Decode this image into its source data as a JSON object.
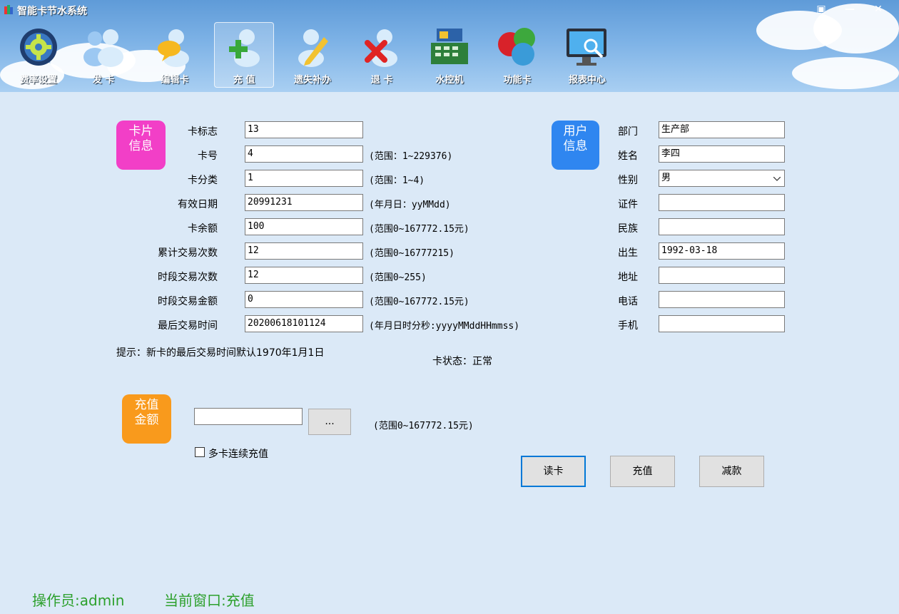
{
  "window": {
    "title": "智能卡节水系统",
    "controls": [
      "▣",
      "—",
      "✕"
    ]
  },
  "toolbar": [
    {
      "label": "费率设置",
      "icon": "gear-icon"
    },
    {
      "label": "发  卡",
      "icon": "users-icon"
    },
    {
      "label": "编辑卡",
      "icon": "user-chat-icon"
    },
    {
      "label": "充  值",
      "icon": "user-add-icon",
      "active": true
    },
    {
      "label": "遗失补办",
      "icon": "user-edit-icon"
    },
    {
      "label": "退  卡",
      "icon": "user-remove-icon"
    },
    {
      "label": "水控机",
      "icon": "cash-register-icon"
    },
    {
      "label": "功能卡",
      "icon": "color-balls-icon"
    },
    {
      "label": "报表中心",
      "icon": "monitor-search-icon"
    }
  ],
  "card_info": {
    "badge": [
      "卡片",
      "信息"
    ],
    "fields": [
      {
        "label": "卡标志",
        "value": "13",
        "hint": ""
      },
      {
        "label": "卡号",
        "value": "4",
        "hint": "(范围：1~229376)"
      },
      {
        "label": "卡分类",
        "value": "1",
        "hint": "(范围：1~4)"
      },
      {
        "label": "有效日期",
        "value": "20991231",
        "hint": "(年月日：yyMMdd)"
      },
      {
        "label": "卡余额",
        "value": "100",
        "hint": "(范围0~167772.15元)"
      },
      {
        "label": "累计交易次数",
        "value": "12",
        "hint": "(范围0~16777215)"
      },
      {
        "label": "时段交易次数",
        "value": "12",
        "hint": "(范围0~255)"
      },
      {
        "label": "时段交易金额",
        "value": "0",
        "hint": "(范围0~167772.15元)"
      },
      {
        "label": "最后交易时间",
        "value": "20200618101124",
        "hint": "(年月日时分秒:yyyyMMddHHmmss)"
      }
    ],
    "tip": "提示：新卡的最后交易时间默认1970年1月1日",
    "card_status": "卡状态：正常"
  },
  "user_info": {
    "badge": [
      "用户",
      "信息"
    ],
    "fields": [
      {
        "label": "部门",
        "value": "生产部"
      },
      {
        "label": "姓名",
        "value": "李四"
      },
      {
        "label": "性别",
        "value": "男",
        "select": true
      },
      {
        "label": "证件",
        "value": ""
      },
      {
        "label": "民族",
        "value": ""
      },
      {
        "label": "出生",
        "value": "1992-03-18"
      },
      {
        "label": "地址",
        "value": ""
      },
      {
        "label": "电话",
        "value": ""
      },
      {
        "label": "手机",
        "value": ""
      }
    ]
  },
  "recharge": {
    "badge": [
      "充值",
      "金额"
    ],
    "amount": "",
    "browse_label": "...",
    "hint": "(范围0~167772.15元)",
    "multi_card_label": "多卡连续充值",
    "multi_card_checked": false
  },
  "actions": {
    "read_card": "读卡",
    "recharge": "充值",
    "deduct": "减款"
  },
  "statusbar": {
    "operator_label": "操作员:",
    "operator": "admin",
    "window_label": "当前窗口:",
    "window": "充值"
  },
  "colors": {
    "card_badge": "#f23fc7",
    "user_badge": "#2f86f0",
    "recharge_badge": "#f99a1c",
    "status_text": "#2ca02c",
    "focus_border": "#0078d7"
  }
}
